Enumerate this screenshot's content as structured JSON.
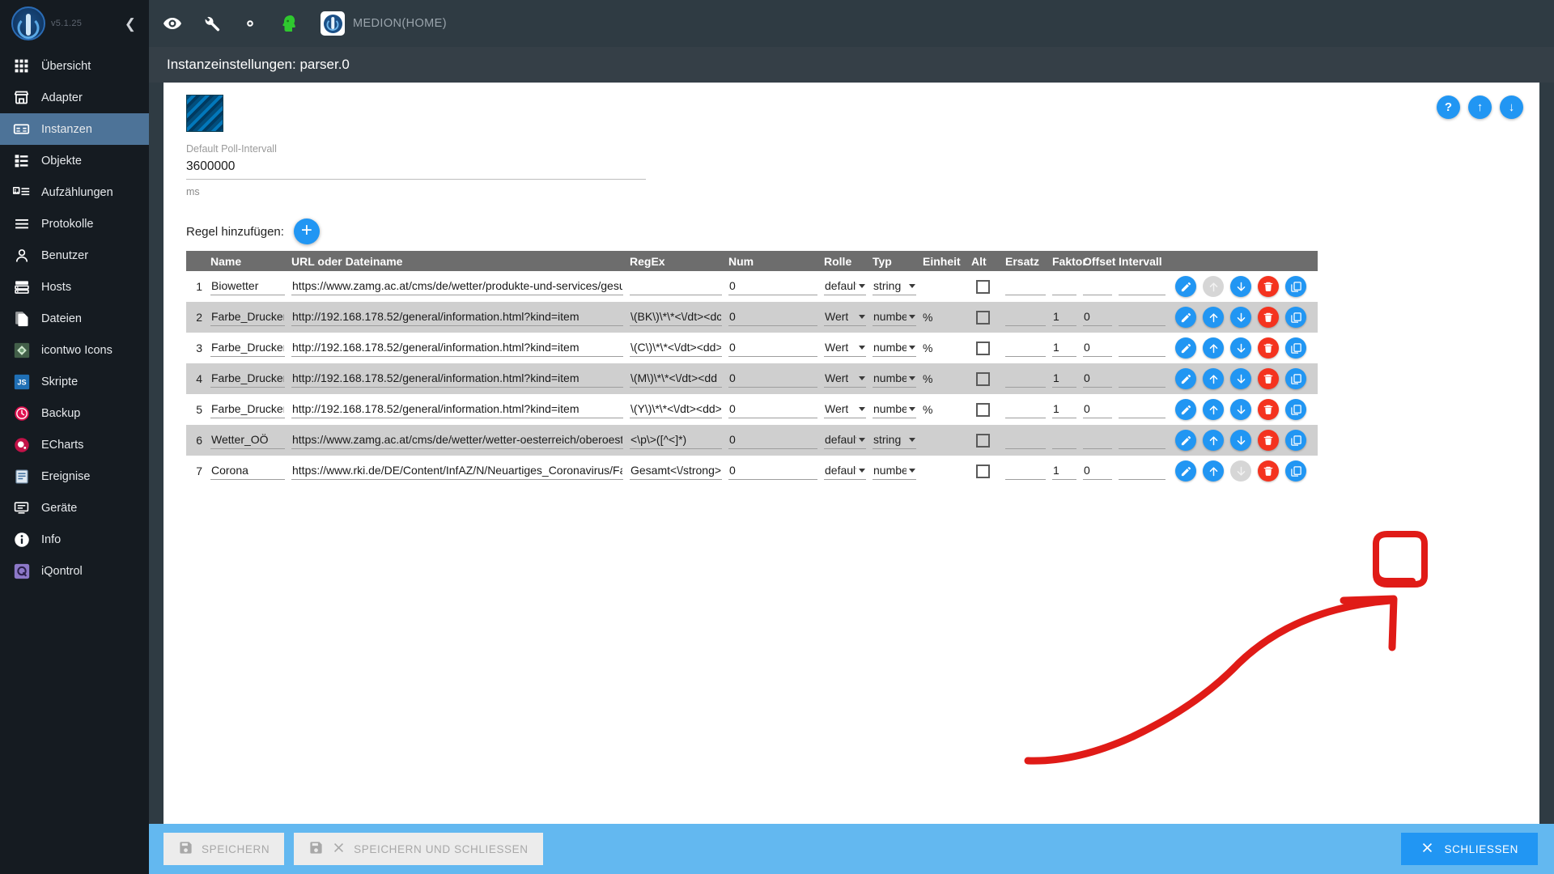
{
  "sidebar": {
    "version": "v5.1.25",
    "collapse_icon": "chevron-left-icon",
    "items": [
      {
        "label": "Übersicht",
        "icon": "grid-icon",
        "active": false
      },
      {
        "label": "Adapter",
        "icon": "store-icon",
        "active": false
      },
      {
        "label": "Instanzen",
        "icon": "instances-icon",
        "active": true
      },
      {
        "label": "Objekte",
        "icon": "list-icon",
        "active": false
      },
      {
        "label": "Aufzählungen",
        "icon": "enum-icon",
        "active": false
      },
      {
        "label": "Protokolle",
        "icon": "lines-icon",
        "active": false
      },
      {
        "label": "Benutzer",
        "icon": "user-icon",
        "active": false
      },
      {
        "label": "Hosts",
        "icon": "hosts-icon",
        "active": false
      },
      {
        "label": "Dateien",
        "icon": "files-icon",
        "active": false
      },
      {
        "label": "icontwo Icons",
        "icon": "icontwo-icon",
        "active": false
      },
      {
        "label": "Skripte",
        "icon": "javascript-icon",
        "active": false
      },
      {
        "label": "Backup",
        "icon": "backup-clock-icon",
        "active": false
      },
      {
        "label": "ECharts",
        "icon": "echarts-icon",
        "active": false
      },
      {
        "label": "Ereignise",
        "icon": "events-icon",
        "active": false
      },
      {
        "label": "Geräte",
        "icon": "devices-icon",
        "active": false
      },
      {
        "label": "Info",
        "icon": "info-icon",
        "active": false
      },
      {
        "label": "iQontrol",
        "icon": "iqontrol-icon",
        "active": false
      }
    ]
  },
  "topbar": {
    "icons": [
      "eye-icon",
      "wrench-icon",
      "gear-icon",
      "head-icon"
    ],
    "host_icon": "iobroker-logo-icon",
    "hostname": "MEDION(HOME)"
  },
  "titlebar": {
    "title": "Instanzeinstellungen: parser.0"
  },
  "panel": {
    "instance_icon": "parser-adapter-icon",
    "actions": [
      {
        "name": "help-button",
        "glyph": "?"
      },
      {
        "name": "upload-button",
        "glyph": "↑"
      },
      {
        "name": "download-button",
        "glyph": "↓"
      }
    ],
    "poll_interval": {
      "label": "Default Poll-Intervall",
      "value": "3600000",
      "unit": "ms"
    },
    "add_rule": {
      "label": "Regel hinzufügen:",
      "button_glyph": "+"
    }
  },
  "table": {
    "columns": [
      "Name",
      "URL oder Dateiname",
      "RegEx",
      "Num",
      "Rolle",
      "Typ",
      "Einheit",
      "Alt",
      "Ersatz",
      "Faktor",
      "Offset",
      "Intervall"
    ],
    "rows": [
      {
        "num": "1",
        "name": "Biowetter",
        "url": "https://www.zamg.ac.at/cms/de/wetter/produkte-und-services/gesundh",
        "regex": "",
        "numval": "0",
        "rolle": "default",
        "typ": "string",
        "einheit": "",
        "alt": false,
        "ersatz": "",
        "faktor": "",
        "offset": "",
        "intervall": "",
        "up_disabled": true,
        "down_disabled": false,
        "highlighted": false
      },
      {
        "num": "2",
        "name": "Farbe_Drucker_I",
        "url": "http://192.168.178.52/general/information.html?kind=item",
        "regex": "\\(BK\\)\\*\\*<\\/dt><dc",
        "numval": "0",
        "rolle": "Wert",
        "typ": "number",
        "einheit": "%",
        "alt": false,
        "ersatz": "",
        "faktor": "1",
        "offset": "0",
        "intervall": "",
        "up_disabled": false,
        "down_disabled": false,
        "highlighted": false
      },
      {
        "num": "3",
        "name": "Farbe_Drucker_(",
        "url": "http://192.168.178.52/general/information.html?kind=item",
        "regex": "\\(C\\)\\*\\*<\\/dt><dd>",
        "numval": "0",
        "rolle": "Wert",
        "typ": "number",
        "einheit": "%",
        "alt": false,
        "ersatz": "",
        "faktor": "1",
        "offset": "0",
        "intervall": "",
        "up_disabled": false,
        "down_disabled": false,
        "highlighted": false
      },
      {
        "num": "4",
        "name": "Farbe_Drucker_I",
        "url": "http://192.168.178.52/general/information.html?kind=item",
        "regex": "\\(M\\)\\*\\*<\\/dt><dd",
        "numval": "0",
        "rolle": "Wert",
        "typ": "number",
        "einheit": "%",
        "alt": false,
        "ersatz": "",
        "faktor": "1",
        "offset": "0",
        "intervall": "",
        "up_disabled": false,
        "down_disabled": false,
        "highlighted": false
      },
      {
        "num": "5",
        "name": "Farbe_Drucker_Y",
        "url": "http://192.168.178.52/general/information.html?kind=item",
        "regex": "\\(Y\\)\\*\\*<\\/dt><dd>",
        "numval": "0",
        "rolle": "Wert",
        "typ": "number",
        "einheit": "%",
        "alt": false,
        "ersatz": "",
        "faktor": "1",
        "offset": "0",
        "intervall": "",
        "up_disabled": false,
        "down_disabled": false,
        "highlighted": false
      },
      {
        "num": "6",
        "name": "Wetter_OÖ",
        "url": "https://www.zamg.ac.at/cms/de/wetter/wetter-oesterreich/oberoesterre",
        "regex": "<\\p\\>([^<]*)",
        "numval": "0",
        "rolle": "default",
        "typ": "string",
        "einheit": "",
        "alt": false,
        "ersatz": "",
        "faktor": "",
        "offset": "",
        "intervall": "",
        "up_disabled": false,
        "down_disabled": false,
        "highlighted": false
      },
      {
        "num": "7",
        "name": "Corona",
        "url": "https://www.rki.de/DE/Content/InfAZ/N/Neuartiges_Coronavirus/Fallzal",
        "regex": "Gesamt<\\/strong><",
        "numval": "0",
        "rolle": "default",
        "typ": "number",
        "einheit": "",
        "alt": false,
        "ersatz": "",
        "faktor": "1",
        "offset": "0",
        "intervall": "",
        "up_disabled": false,
        "down_disabled": true,
        "highlighted": true
      }
    ],
    "row_actions": [
      {
        "name": "edit-row-button",
        "icon": "pencil-icon"
      },
      {
        "name": "move-up-button",
        "icon": "arrow-up-icon"
      },
      {
        "name": "move-down-button",
        "icon": "arrow-down-icon"
      },
      {
        "name": "delete-row-button",
        "icon": "trash-icon"
      },
      {
        "name": "duplicate-row-button",
        "icon": "copy-icon"
      }
    ]
  },
  "footer": {
    "save_label": "SPEICHERN",
    "save_close_label": "SPEICHERN UND SCHLIESSEN",
    "close_label": "SCHLIESSEN"
  },
  "colors": {
    "accent_blue": "#2196f3",
    "danger_red": "#f4331f",
    "sidebar_bg": "#151b21",
    "sidebar_active": "#4d7398",
    "topbar_bg": "#2f3b43",
    "footer_bg": "#63b8f0",
    "annotation_red": "#e01b17"
  }
}
